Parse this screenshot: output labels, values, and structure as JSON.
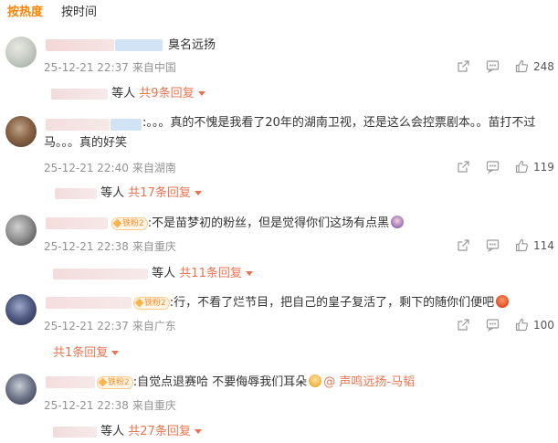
{
  "tabs": [
    {
      "label": "按热度",
      "active": true
    },
    {
      "label": "按时间",
      "active": false
    }
  ],
  "icons": {
    "share": "share-icon",
    "comment": "comment-icon",
    "like": "thumb-up-icon",
    "fan": "fan-badge-icon"
  },
  "colors": {
    "accent": "#ff8200",
    "link": "#eb7350",
    "meta": "#939393"
  },
  "comments": [
    {
      "text": "臭名远扬",
      "date": "25-12-21 22:37",
      "location": "来自中国",
      "likes": "248",
      "reply_suffix": "等人",
      "reply_link": "共9条回复"
    },
    {
      "text": ":。。。真的不愧是我看了20年的湖南卫视，还是这么会控票剧本。。苗打不过马。。。真的好笑",
      "date": "25-12-21 22:40",
      "location": "来自湖南",
      "likes": "119",
      "reply_suffix": "等人",
      "reply_link": "共17条回复"
    },
    {
      "fan_badge": "铁粉2",
      "text": ":不是苗梦初的粉丝，但是觉得你们这场有点黑",
      "date": "25-12-21 22:38",
      "location": "来自重庆",
      "likes": "114",
      "reply_suffix": "等人",
      "reply_link": "共11条回复"
    },
    {
      "fan_badge": "铁粉2",
      "text": ":行，不看了烂节目，把自己的皇子复活了，剩下的随你们便吧",
      "date": "25-12-21 22:37",
      "location": "来自广东",
      "likes": "100",
      "reply_link": "共1条回复"
    },
    {
      "fan_badge": "铁粉2",
      "text": ":自觉点退赛哈 不要侮辱我们耳朵",
      "mention": "@ 声鸣远扬-马韬",
      "date": "25-12-21 22:38",
      "location": "来自重庆",
      "reply_suffix": "等人",
      "reply_link": "共27条回复"
    }
  ]
}
